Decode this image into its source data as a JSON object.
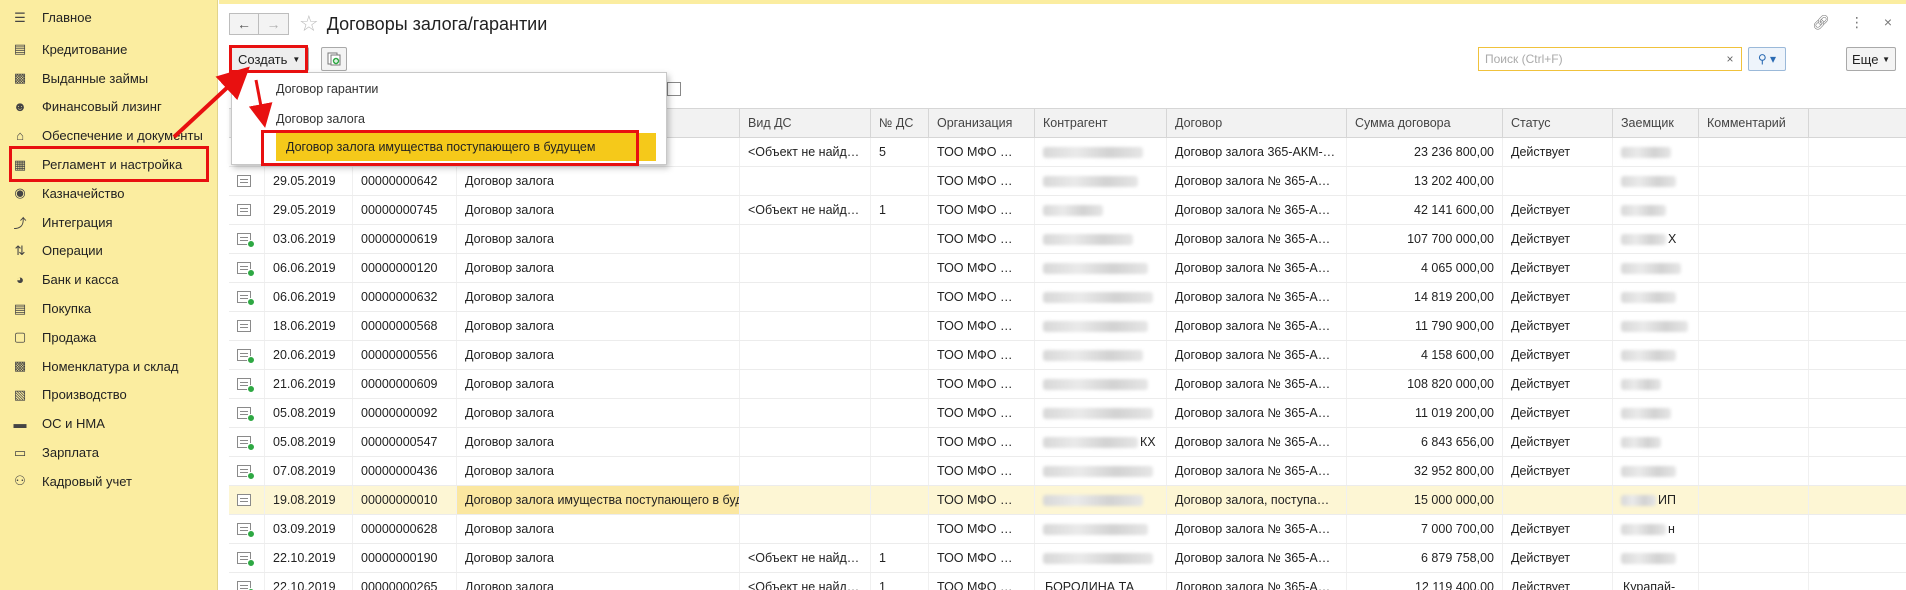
{
  "sidebar": {
    "items": [
      {
        "label": "Главное",
        "icon": "menu-lines-icon"
      },
      {
        "label": "Кредитование",
        "icon": "document-icon"
      },
      {
        "label": "Выданные займы",
        "icon": "briefcase-icon"
      },
      {
        "label": "Финансовый лизинг",
        "icon": "people-icon"
      },
      {
        "label": "Обеспечение и документы",
        "icon": "house-icon"
      },
      {
        "label": "Регламент и настройка",
        "icon": "table-icon"
      },
      {
        "label": "Казначейство",
        "icon": "coins-icon"
      },
      {
        "label": "Интеграция",
        "icon": "plug-icon"
      },
      {
        "label": "Операции",
        "icon": "operations-icon"
      },
      {
        "label": "Банк и касса",
        "icon": "bank-icon"
      },
      {
        "label": "Покупка",
        "icon": "cart-icon"
      },
      {
        "label": "Продажа",
        "icon": "bag-icon"
      },
      {
        "label": "Номенклатура и склад",
        "icon": "grid-icon"
      },
      {
        "label": "Производство",
        "icon": "factory-icon"
      },
      {
        "label": "ОС и НМА",
        "icon": "car-icon"
      },
      {
        "label": "Зарплата",
        "icon": "money-icon"
      },
      {
        "label": "Кадровый учет",
        "icon": "person-icon"
      }
    ]
  },
  "header": {
    "title": "Договоры залога/гарантии",
    "back_icon": "arrow-left-icon",
    "forward_icon": "arrow-right-icon",
    "link_icon": "link-icon",
    "menu_icon": "kebab-icon",
    "close_icon": "close-icon"
  },
  "toolbar": {
    "create_label": "Создать",
    "search_placeholder": "Поиск (Ctrl+F)",
    "more_label": "Еще"
  },
  "dropdown": {
    "items": [
      "Договор гарантии",
      "Договор залога",
      "Договор залога имущества поступающего в будущем"
    ],
    "highlighted_index": 2
  },
  "table": {
    "columns": [
      "",
      "",
      "",
      "",
      "Вид ДС",
      "№ ДС",
      "Организация",
      "Контрагент",
      "Договор",
      "Сумма договора",
      "Статус",
      "Заемщик",
      "Комментарий"
    ],
    "rows": [
      {
        "date": "",
        "number": "",
        "type": "",
        "vid_ds": "<Объект не найд…",
        "ds_num": "5",
        "org": "ТОО МФО …",
        "contractor_suffix": "",
        "contract": "Договор залога 365-АКМ-…",
        "sum": "23 236 800,00",
        "status": "Действует",
        "borrower_suffix": "",
        "icon": "plain"
      },
      {
        "date": "29.05.2019",
        "number": "00000000642",
        "type": "Договор залога",
        "vid_ds": "",
        "ds_num": "",
        "org": "ТОО МФО …",
        "contractor_suffix": "",
        "contract": "Договор залога № 365-А…",
        "sum": "13 202 400,00",
        "status": "",
        "borrower_suffix": "",
        "icon": "plain"
      },
      {
        "date": "29.05.2019",
        "number": "00000000745",
        "type": "Договор залога",
        "vid_ds": "<Объект не найд…",
        "ds_num": "1",
        "org": "ТОО МФО …",
        "contractor_suffix": "",
        "contract": "Договор залога № 365-А…",
        "sum": "42 141 600,00",
        "status": "Действует",
        "borrower_suffix": "",
        "icon": "plain"
      },
      {
        "date": "03.06.2019",
        "number": "00000000619",
        "type": "Договор залога",
        "vid_ds": "",
        "ds_num": "",
        "org": "ТОО МФО …",
        "contractor_suffix": "",
        "contract": "Договор залога № 365-А…",
        "sum": "107 700 000,00",
        "status": "Действует",
        "borrower_suffix": "Х",
        "icon": "green"
      },
      {
        "date": "06.06.2019",
        "number": "00000000120",
        "type": "Договор залога",
        "vid_ds": "",
        "ds_num": "",
        "org": "ТОО МФО …",
        "contractor_suffix": "",
        "contract": "Договор залога № 365-А…",
        "sum": "4 065 000,00",
        "status": "Действует",
        "borrower_suffix": "",
        "icon": "green"
      },
      {
        "date": "06.06.2019",
        "number": "00000000632",
        "type": "Договор залога",
        "vid_ds": "",
        "ds_num": "",
        "org": "ТОО МФО …",
        "contractor_suffix": "",
        "contract": "Договор залога № 365-А…",
        "sum": "14 819 200,00",
        "status": "Действует",
        "borrower_suffix": "",
        "icon": "green"
      },
      {
        "date": "18.06.2019",
        "number": "00000000568",
        "type": "Договор залога",
        "vid_ds": "",
        "ds_num": "",
        "org": "ТОО МФО …",
        "contractor_suffix": "",
        "contract": "Договор залога № 365-А…",
        "sum": "11 790 900,00",
        "status": "Действует",
        "borrower_suffix": "",
        "icon": "plain"
      },
      {
        "date": "20.06.2019",
        "number": "00000000556",
        "type": "Договор залога",
        "vid_ds": "",
        "ds_num": "",
        "org": "ТОО МФО …",
        "contractor_suffix": "",
        "contract": "Договор залога № 365-А…",
        "sum": "4 158 600,00",
        "status": "Действует",
        "borrower_suffix": "",
        "icon": "green"
      },
      {
        "date": "21.06.2019",
        "number": "00000000609",
        "type": "Договор залога",
        "vid_ds": "",
        "ds_num": "",
        "org": "ТОО МФО …",
        "contractor_suffix": "",
        "contract": "Договор залога № 365-А…",
        "sum": "108 820 000,00",
        "status": "Действует",
        "borrower_suffix": "",
        "icon": "green"
      },
      {
        "date": "05.08.2019",
        "number": "00000000092",
        "type": "Договор залога",
        "vid_ds": "",
        "ds_num": "",
        "org": "ТОО МФО …",
        "contractor_suffix": "",
        "contract": "Договор залога № 365-А…",
        "sum": "11 019 200,00",
        "status": "Действует",
        "borrower_suffix": "",
        "icon": "green"
      },
      {
        "date": "05.08.2019",
        "number": "00000000547",
        "type": "Договор залога",
        "vid_ds": "",
        "ds_num": "",
        "org": "ТОО МФО …",
        "contractor_suffix": "КХ",
        "contract": "Договор залога № 365-А…",
        "sum": "6 843 656,00",
        "status": "Действует",
        "borrower_suffix": "",
        "icon": "green"
      },
      {
        "date": "07.08.2019",
        "number": "00000000436",
        "type": "Договор залога",
        "vid_ds": "",
        "ds_num": "",
        "org": "ТОО МФО …",
        "contractor_suffix": "",
        "contract": "Договор залога № 365-А…",
        "sum": "32 952 800,00",
        "status": "Действует",
        "borrower_suffix": "",
        "icon": "green"
      },
      {
        "date": "19.08.2019",
        "number": "00000000010",
        "type": "Договор залога имущества поступающего в будущ…",
        "vid_ds": "",
        "ds_num": "",
        "org": "ТОО МФО …",
        "contractor_suffix": "",
        "contract": "Договор залога, поступа…",
        "sum": "15 000 000,00",
        "status": "",
        "borrower_suffix": "ИП",
        "icon": "plain",
        "selected": true
      },
      {
        "date": "03.09.2019",
        "number": "00000000628",
        "type": "Договор залога",
        "vid_ds": "",
        "ds_num": "",
        "org": "ТОО МФО …",
        "contractor_suffix": "",
        "contract": "Договор залога № 365-А…",
        "sum": "7 000 700,00",
        "status": "Действует",
        "borrower_suffix": "н",
        "icon": "green"
      },
      {
        "date": "22.10.2019",
        "number": "00000000190",
        "type": "Договор залога",
        "vid_ds": "<Объект не найд…",
        "ds_num": "1",
        "org": "ТОО МФО …",
        "contractor_suffix": "",
        "contract": "Договор залога № 365-А…",
        "sum": "6 879 758,00",
        "status": "Действует",
        "borrower_suffix": "",
        "icon": "green"
      },
      {
        "date": "22.10.2019",
        "number": "00000000265",
        "type": "Договор залога",
        "vid_ds": "<Объект не найд…",
        "ds_num": "1",
        "org": "ТОО МФО …",
        "contractor_suffix": "БОРОДИНА ТА",
        "contract": "Договор залога № 365-А…",
        "sum": "12 119 400,00",
        "status": "Действует",
        "borrower_suffix": "Курапай-",
        "icon": "green"
      }
    ]
  },
  "colors": {
    "sidebar_bg": "#fbeda0",
    "highlight": "#f5c91a",
    "annotation_red": "#e81010"
  }
}
